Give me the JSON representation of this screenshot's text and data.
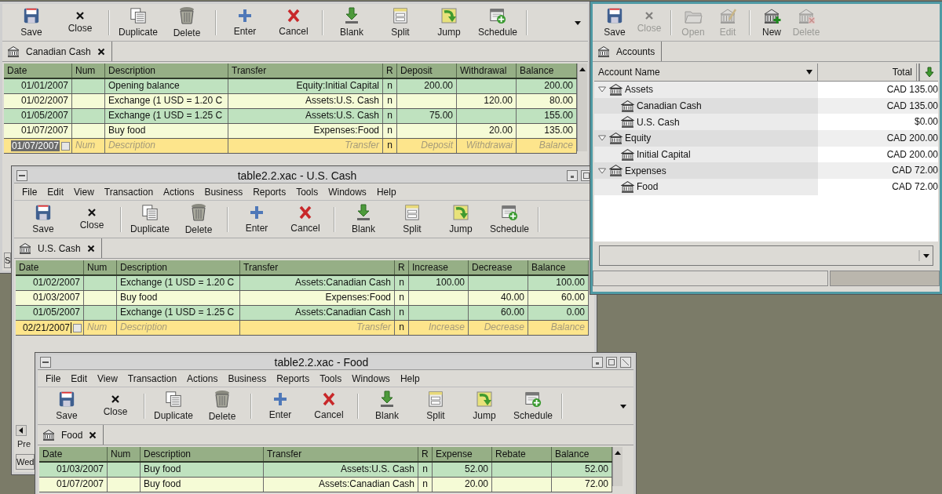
{
  "windows": [
    {
      "kind": "register",
      "toolbar": [
        {
          "kind": "button",
          "label": "Save"
        },
        {
          "kind": "button",
          "label": "Close"
        },
        {
          "kind": "separator"
        },
        {
          "kind": "button",
          "label": "Duplicate"
        },
        {
          "kind": "button",
          "label": "Delete"
        },
        {
          "kind": "separator"
        },
        {
          "kind": "button",
          "label": "Enter"
        },
        {
          "kind": "button",
          "label": "Cancel"
        },
        {
          "kind": "separator"
        },
        {
          "kind": "button",
          "label": "Blank"
        },
        {
          "kind": "button",
          "label": "Split"
        },
        {
          "kind": "button",
          "label": "Jump"
        },
        {
          "kind": "button",
          "label": "Schedule"
        },
        {
          "kind": "separator"
        }
      ],
      "tab": {
        "label": "Canadian Cash"
      },
      "columns": [
        "Date",
        "Num",
        "Description",
        "Transfer",
        "R",
        "Deposit",
        "Withdrawal",
        "Balance"
      ],
      "rows": [
        {
          "date": "01/01/2007",
          "description": "Opening balance",
          "transfer": "Equity:Initial Capital",
          "r": "n",
          "debit": "200.00",
          "balance": "200.00"
        },
        {
          "date": "01/02/2007",
          "description": "Exchange (1 USD = 1.20 C",
          "transfer": "Assets:U.S. Cash",
          "r": "n",
          "credit": "120.00",
          "balance": "80.00"
        },
        {
          "date": "01/05/2007",
          "description": "Exchange (1 USD = 1.25 C",
          "transfer": "Assets:U.S. Cash",
          "r": "n",
          "debit": "75.00",
          "balance": "155.00"
        },
        {
          "date": "01/07/2007",
          "description": "Buy food",
          "transfer": "Expenses:Food",
          "r": "n",
          "credit": "20.00",
          "balance": "135.00"
        }
      ],
      "blank_row": {
        "date": "01/07/2007",
        "date_selected": true,
        "r": "n",
        "placeholders": [
          "Num",
          "Description",
          "Transfer",
          "Deposit",
          "Withdrawai",
          "Balance"
        ]
      },
      "status_fragment": "S"
    },
    {
      "kind": "accounts",
      "toolbar": [
        {
          "kind": "button",
          "label": "Save",
          "disabled": false
        },
        {
          "kind": "button",
          "label": "Close",
          "disabled": true
        },
        {
          "kind": "separator"
        },
        {
          "kind": "button",
          "label": "Open",
          "disabled": true
        },
        {
          "kind": "button",
          "label": "Edit",
          "disabled": true
        },
        {
          "kind": "separator"
        },
        {
          "kind": "button",
          "label": "New",
          "disabled": false
        },
        {
          "kind": "button",
          "label": "Delete",
          "disabled": true
        }
      ],
      "tab": {
        "label": "Accounts"
      },
      "columns": [
        "Account Name",
        "Total"
      ],
      "accounts": [
        {
          "name": "Assets",
          "total": "CAD 135.00",
          "expanded": true,
          "children": [
            {
              "name": "Canadian Cash",
              "total": "CAD 135.00"
            },
            {
              "name": "U.S. Cash",
              "total": "$0.00"
            }
          ]
        },
        {
          "name": "Equity",
          "total": "CAD 200.00",
          "expanded": true,
          "children": [
            {
              "name": "Initial Capital",
              "total": "CAD 200.00"
            }
          ]
        },
        {
          "name": "Expenses",
          "total": "CAD 72.00",
          "expanded": true,
          "children": [
            {
              "name": "Food",
              "total": "CAD 72.00"
            }
          ]
        }
      ]
    },
    {
      "kind": "register",
      "title": "table2.2.xac - U.S. Cash",
      "menu": [
        "File",
        "Edit",
        "View",
        "Transaction",
        "Actions",
        "Business",
        "Reports",
        "Tools",
        "Windows",
        "Help"
      ],
      "toolbar": [
        {
          "kind": "button",
          "label": "Save"
        },
        {
          "kind": "button",
          "label": "Close"
        },
        {
          "kind": "separator"
        },
        {
          "kind": "button",
          "label": "Duplicate"
        },
        {
          "kind": "button",
          "label": "Delete"
        },
        {
          "kind": "separator"
        },
        {
          "kind": "button",
          "label": "Enter"
        },
        {
          "kind": "button",
          "label": "Cancel"
        },
        {
          "kind": "separator"
        },
        {
          "kind": "button",
          "label": "Blank"
        },
        {
          "kind": "button",
          "label": "Split"
        },
        {
          "kind": "button",
          "label": "Jump"
        },
        {
          "kind": "button",
          "label": "Schedule"
        },
        {
          "kind": "separator"
        }
      ],
      "tab": {
        "label": "U.S. Cash"
      },
      "columns": [
        "Date",
        "Num",
        "Description",
        "Transfer",
        "R",
        "Increase",
        "Decrease",
        "Balance"
      ],
      "rows": [
        {
          "date": "01/02/2007",
          "description": "Exchange (1 USD = 1.20 C",
          "transfer": "Assets:Canadian Cash",
          "r": "n",
          "debit": "100.00",
          "balance": "100.00"
        },
        {
          "date": "01/03/2007",
          "description": "Buy food",
          "transfer": "Expenses:Food",
          "r": "n",
          "credit": "40.00",
          "balance": "60.00"
        },
        {
          "date": "01/05/2007",
          "description": "Exchange (1 USD = 1.25 C",
          "transfer": "Assets:Canadian Cash",
          "r": "n",
          "credit": "60.00",
          "balance": "0.00"
        }
      ],
      "blank_row": {
        "date": "02/21/2007",
        "date_selected": false,
        "r": "n",
        "placeholders": [
          "Num",
          "Description",
          "Transfer",
          "Increase",
          "Decrease",
          "Balance"
        ]
      },
      "summary_fragment": "Pre",
      "status_fragment": "Wed"
    },
    {
      "kind": "register",
      "title": "table2.2.xac - Food",
      "menu": [
        "File",
        "Edit",
        "View",
        "Transaction",
        "Actions",
        "Business",
        "Reports",
        "Tools",
        "Windows",
        "Help"
      ],
      "toolbar": [
        {
          "kind": "button",
          "label": "Save"
        },
        {
          "kind": "button",
          "label": "Close"
        },
        {
          "kind": "separator"
        },
        {
          "kind": "button",
          "label": "Duplicate"
        },
        {
          "kind": "button",
          "label": "Delete"
        },
        {
          "kind": "separator"
        },
        {
          "kind": "button",
          "label": "Enter"
        },
        {
          "kind": "button",
          "label": "Cancel"
        },
        {
          "kind": "separator"
        },
        {
          "kind": "button",
          "label": "Blank"
        },
        {
          "kind": "button",
          "label": "Split"
        },
        {
          "kind": "button",
          "label": "Jump"
        },
        {
          "kind": "button",
          "label": "Schedule"
        },
        {
          "kind": "separator"
        }
      ],
      "tab": {
        "label": "Food"
      },
      "columns": [
        "Date",
        "Num",
        "Description",
        "Transfer",
        "R",
        "Expense",
        "Rebate",
        "Balance"
      ],
      "rows": [
        {
          "date": "01/03/2007",
          "description": "Buy food",
          "transfer": "Assets:U.S. Cash",
          "r": "n",
          "debit": "52.00",
          "balance": "52.00"
        },
        {
          "date": "01/07/2007",
          "description": "Buy food",
          "transfer": "Assets:Canadian Cash",
          "r": "n",
          "debit": "20.00",
          "balance": "72.00"
        }
      ]
    }
  ]
}
